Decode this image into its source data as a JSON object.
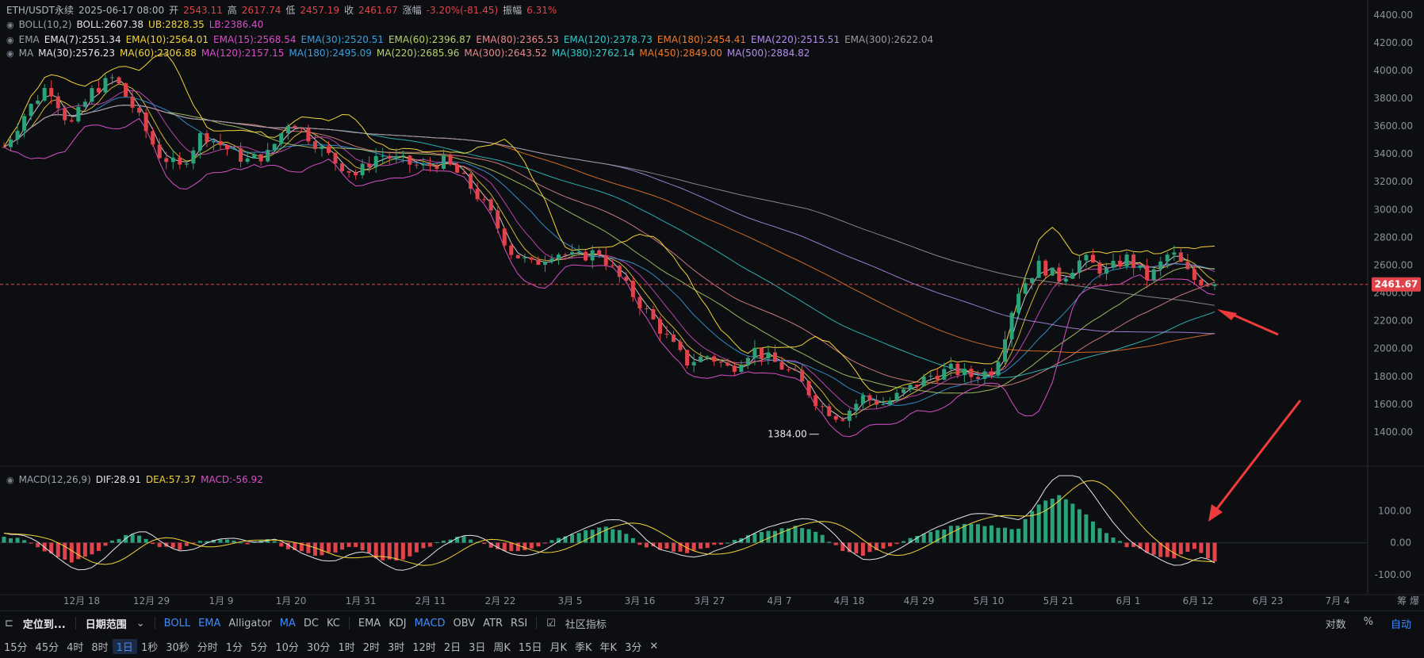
{
  "header": {
    "symbol": "ETH/USDT永续",
    "time": "2025-06-17 08:00",
    "open_label": "开",
    "open": "2543.11",
    "high_label": "高",
    "high": "2617.74",
    "low_label": "低",
    "low": "2457.19",
    "close_label": "收",
    "close": "2461.67",
    "change_label": "涨幅",
    "change": "-3.20%(-81.45)",
    "amp_label": "振幅",
    "amp": "6.31%"
  },
  "boll": {
    "name": "BOLL(10,2)",
    "mid": "BOLL:2607.38",
    "ub": "UB:2828.35",
    "lb": "LB:2386.40"
  },
  "ema": {
    "name": "EMA",
    "items": [
      {
        "t": "EMA(7):2551.34",
        "c": "#e6e6e6"
      },
      {
        "t": "EMA(10):2564.01",
        "c": "#f2d33a"
      },
      {
        "t": "EMA(15):2568.54",
        "c": "#d84ec8"
      },
      {
        "t": "EMA(30):2520.51",
        "c": "#3aa0e0"
      },
      {
        "t": "EMA(60):2396.87",
        "c": "#b6d36a"
      },
      {
        "t": "EMA(80):2365.53",
        "c": "#e88a8a"
      },
      {
        "t": "EMA(120):2378.73",
        "c": "#34c9c9"
      },
      {
        "t": "EMA(180):2454.41",
        "c": "#f07a28"
      },
      {
        "t": "EMA(220):2515.51",
        "c": "#b58cf0"
      },
      {
        "t": "EMA(300):2622.04",
        "c": "#9a9a9a"
      }
    ]
  },
  "ma": {
    "name": "MA",
    "items": [
      {
        "t": "MA(30):2576.23",
        "c": "#e6e6e6"
      },
      {
        "t": "MA(60):2306.88",
        "c": "#f2d33a"
      },
      {
        "t": "MA(120):2157.15",
        "c": "#d84ec8"
      },
      {
        "t": "MA(180):2495.09",
        "c": "#3aa0e0"
      },
      {
        "t": "MA(220):2685.96",
        "c": "#b6d36a"
      },
      {
        "t": "MA(300):2643.52",
        "c": "#e88a8a"
      },
      {
        "t": "MA(380):2762.14",
        "c": "#34c9c9"
      },
      {
        "t": "MA(450):2849.00",
        "c": "#f07a28"
      },
      {
        "t": "MA(500):2884.82",
        "c": "#b58cf0"
      }
    ]
  },
  "macd": {
    "name": "MACD(12,26,9)",
    "dif": "DIF:28.91",
    "dea": "DEA:57.37",
    "macd": "MACD:-56.92"
  },
  "colors": {
    "up": "#2aa37a",
    "down": "#e0444a",
    "bg": "#0d0e12",
    "price_tag": "#e0444a"
  },
  "chart_data": {
    "type": "candlestick",
    "title": "ETH/USDT永续",
    "ylim": [
      1200,
      4450
    ],
    "price_ticks": [
      "4400.00",
      "4200.00",
      "4000.00",
      "3800.00",
      "3600.00",
      "3400.00",
      "3200.00",
      "3000.00",
      "2800.00",
      "2600.00",
      "2400.00",
      "2200.00",
      "2000.00",
      "1800.00",
      "1600.00",
      "1400.00"
    ],
    "last_price": "2461.67",
    "low_annotation": "1384.00",
    "x_ticks": [
      "12月 18",
      "12月 29",
      "1月 9",
      "1月 20",
      "1月 31",
      "2月 11",
      "2月 22",
      "3月 5",
      "3月 16",
      "3月 27",
      "4月 7",
      "4月 18",
      "4月 29",
      "5月 10",
      "5月 21",
      "6月 1",
      "6月 12",
      "6月 23",
      "7月 4"
    ],
    "macd_ticks": [
      "100.00",
      "0.00",
      "-100.00"
    ],
    "macd_ylim": [
      -150,
      210
    ],
    "close_path": [
      3450,
      3700,
      3900,
      3600,
      3850,
      3950,
      3700,
      3400,
      3300,
      3550,
      3450,
      3350,
      3400,
      3650,
      3500,
      3350,
      3250,
      3400,
      3350,
      3300,
      3350,
      3200,
      3000,
      2700,
      2600,
      2700,
      2650,
      2700,
      2500,
      2300,
      2100,
      1900,
      1950,
      1850,
      2000,
      1900,
      1800,
      1600,
      1500,
      1650,
      1600,
      1700,
      1800,
      1850,
      1800,
      1850,
      2400,
      2600,
      2500,
      2650,
      2550,
      2650,
      2500,
      2700,
      2500,
      2461.67
    ],
    "macd_path": [
      20,
      10,
      -30,
      -60,
      -40,
      10,
      30,
      -10,
      -20,
      5,
      10,
      -5,
      10,
      -20,
      -40,
      -30,
      -10,
      -50,
      -60,
      -20,
      10,
      20,
      -10,
      -30,
      -20,
      15,
      30,
      50,
      40,
      -10,
      -20,
      -30,
      -15,
      5,
      25,
      40,
      50,
      30,
      -20,
      -40,
      -15,
      10,
      30,
      50,
      60,
      50,
      40,
      120,
      150,
      100,
      30,
      -10,
      -30,
      -50,
      -20,
      -56.92
    ]
  },
  "toolbar": {
    "locate": "定位到...",
    "range": "日期范围",
    "overlays": [
      "BOLL",
      "EMA",
      "Alligator",
      "MA",
      "DC",
      "KC"
    ],
    "subs": [
      "EMA",
      "KDJ",
      "MACD",
      "OBV",
      "ATR",
      "RSI"
    ],
    "community": "社区指标",
    "log": "对数",
    "pct": "%",
    "auto": "自动"
  },
  "intervals": [
    "15分",
    "45分",
    "4时",
    "8时",
    "1日",
    "1秒",
    "30秒",
    "分时",
    "1分",
    "5分",
    "10分",
    "30分",
    "1时",
    "2时",
    "3时",
    "12时",
    "2日",
    "3日",
    "周K",
    "15日",
    "月K",
    "季K",
    "年K",
    "3分"
  ],
  "active_interval": "1日",
  "close_x": "✕",
  "corner_label": "筹 爆"
}
